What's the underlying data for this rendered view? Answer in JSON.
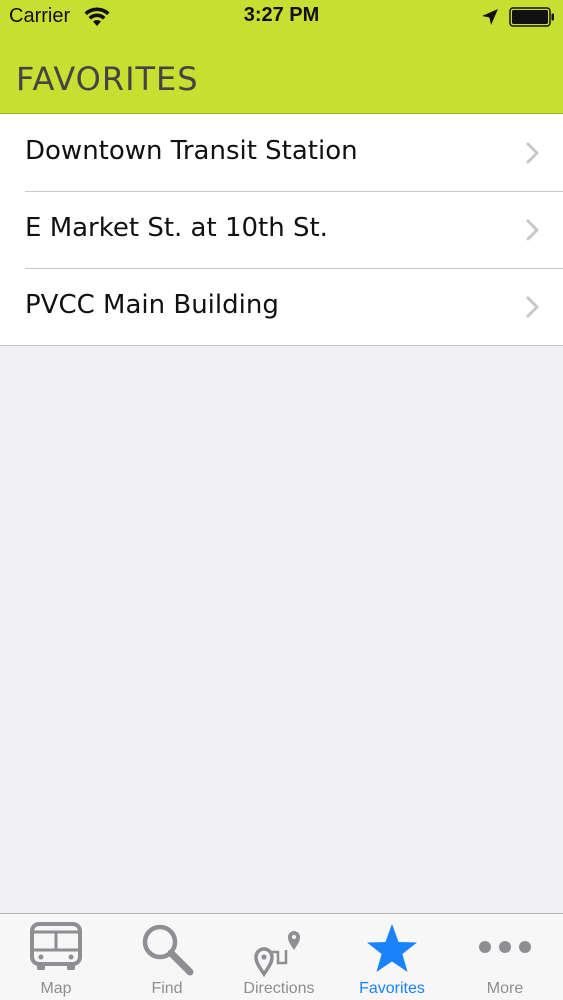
{
  "status": {
    "carrier": "Carrier",
    "time": "3:27 PM"
  },
  "nav": {
    "title": "FAVORITES"
  },
  "favorites": [
    {
      "label": "Downtown Transit Station"
    },
    {
      "label": "E Market St. at 10th St."
    },
    {
      "label": "PVCC Main Building"
    }
  ],
  "tabs": [
    {
      "label": "Map",
      "icon": "bus-icon",
      "active": false
    },
    {
      "label": "Find",
      "icon": "search-icon",
      "active": false
    },
    {
      "label": "Directions",
      "icon": "directions-icon",
      "active": false
    },
    {
      "label": "Favorites",
      "icon": "star-icon",
      "active": true
    },
    {
      "label": "More",
      "icon": "more-icon",
      "active": false
    }
  ],
  "colors": {
    "header": "#c6df31",
    "active_tab": "#1a82fb",
    "inactive_tab": "#8e8e93",
    "background": "#efeff4"
  }
}
